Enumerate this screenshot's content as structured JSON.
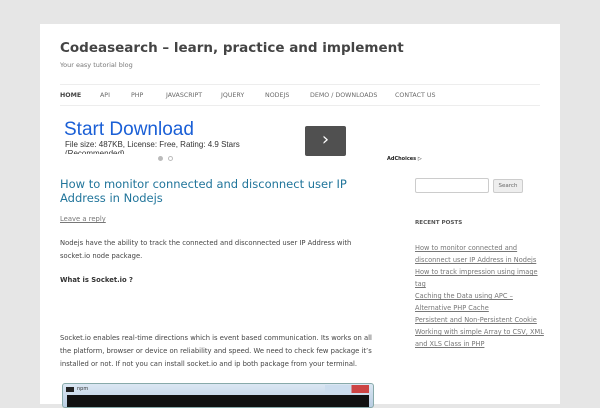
{
  "site": {
    "title": "Codeasearch – learn, practice and implement",
    "tagline": "Your easy tutorial blog"
  },
  "nav": [
    "Home",
    "API",
    "PHP",
    "JavaScript",
    "jQuery",
    "NodeJS",
    "Demo / Downloads",
    "Contact Us"
  ],
  "ad": {
    "headline": "Start Download",
    "subtext": "File size: 487KB, License: Free, Rating: 4.9 Stars",
    "subtext2": "(Recommended)",
    "next": "›",
    "adchoices": "AdChoices ▷"
  },
  "post": {
    "title": "How to monitor connected and disconnect user IP Address in Nodejs",
    "reply": "Leave a reply",
    "p1": "Nodejs have the ability to track the connected and disconnected user IP Address with socket.io node package.",
    "h": "What is Socket.io ?",
    "p2": "Socket.io enables real-time directions which is event based communication. Its works on all the platform, browser or device on reliability and speed. We need to check few package it’s installed or not.  If not you can install socket.io and ip both package from your terminal.",
    "window_title": "npm"
  },
  "sidebar": {
    "search_button": "Search",
    "recent_heading": "Recent Posts",
    "recent": [
      "How to monitor connected and disconnect user IP Address in Nodejs",
      "How to track impression using image tag",
      "Caching the Data using APC – Alternative PHP Cache",
      "Persistent and Non-Persistent Cookie",
      "Working with simple Array to CSV, XML and XLS Class in PHP"
    ]
  }
}
